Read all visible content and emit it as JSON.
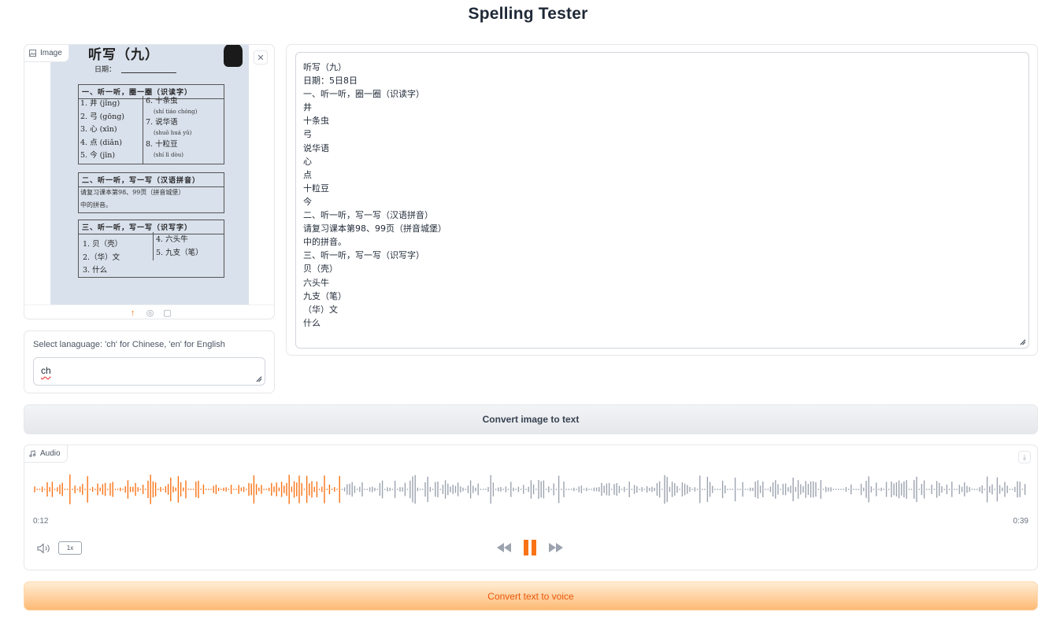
{
  "app": {
    "title": "Spelling Tester"
  },
  "image_block": {
    "label": "Image",
    "close_icon": "close-icon",
    "photo": {
      "heading": "听写（九）",
      "date_label": "日期：",
      "section1_title": "一、听一听，圈一圈（识读字）",
      "section1_left": [
        "1. 井 (jǐng)",
        "2. 弓 (gōng)",
        "3. 心 (xīn)",
        "4. 点 (diǎn)",
        "5. 今 (jīn)"
      ],
      "section1_right": [
        "6. 十条虫",
        "(shí tiáo chóng)",
        "7. 说华语",
        "(shuō huá yǔ)",
        "8. 十粒豆",
        "(shí lì dòu)"
      ],
      "section2_title": "二、听一听，写一写（汉语拼音）",
      "section2_note": [
        "请复习课本第98、99页（拼音城堡）",
        "中的拼音。"
      ],
      "section3_title": "三、听一听，写一写（识写字）",
      "section3_left": [
        "1. 贝（壳）",
        "2.（华）文",
        "3. 什么"
      ],
      "section3_right": [
        "4. 六头牛",
        "5. 九支（笔）"
      ]
    },
    "toolbar": [
      "upload-icon",
      "webcam-icon",
      "clipboard-icon"
    ]
  },
  "language": {
    "label": "Select lanaguage: 'ch' for Chinese, 'en' for English",
    "value": "ch"
  },
  "text_output": {
    "lines": [
      "听写（九）",
      "日期：5日8日",
      "一、听一听，圈一圈（识读字）",
      "井",
      "十条虫",
      "弓",
      "说华语",
      "心",
      "点",
      "十粒豆",
      "今",
      "二、听一听，写一写（汉语拼音）",
      "请复习课本第98、99页（拼音城堡）",
      "中的拼音。",
      "三、听一听，写一写（识写字）",
      "贝（壳）",
      "六头牛",
      "九支（笔）",
      "（华）文",
      "什么"
    ]
  },
  "buttons": {
    "convert_image": "Convert image to text",
    "convert_voice": "Convert text to voice"
  },
  "audio": {
    "label": "Audio",
    "current_time": "0:12",
    "duration": "0:39",
    "played_fraction": 0.31,
    "playback_rate": "1x",
    "is_playing": true,
    "colors": {
      "played": "#f97316",
      "unplayed": "#9ca3af",
      "accent": "#f97316"
    }
  }
}
